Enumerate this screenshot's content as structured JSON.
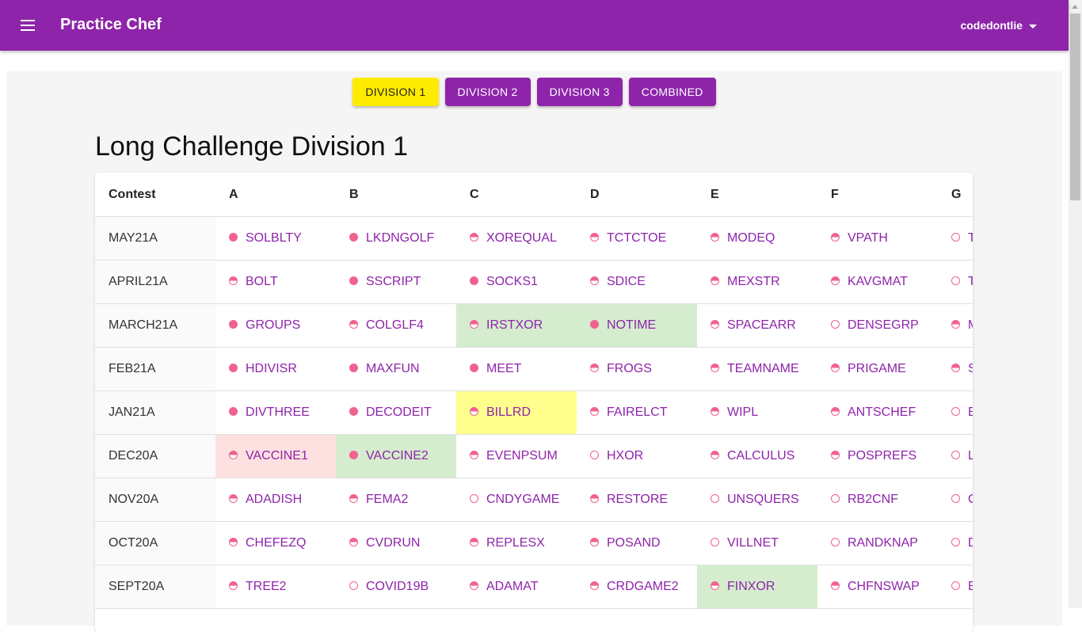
{
  "app": {
    "title": "Practice Chef",
    "user": "codedontlie"
  },
  "tabs": [
    {
      "label": "DIVISION 1",
      "active": true
    },
    {
      "label": "DIVISION 2",
      "active": false
    },
    {
      "label": "DIVISION 3",
      "active": false
    },
    {
      "label": "COMBINED",
      "active": false
    }
  ],
  "page_title": "Long Challenge Division 1",
  "table": {
    "headers": [
      "Contest",
      "A",
      "B",
      "C",
      "D",
      "E",
      "F",
      "G"
    ],
    "rows": [
      {
        "contest": "MAY21A",
        "cells": [
          {
            "code": "SOLBLTY",
            "status": "full"
          },
          {
            "code": "LKDNGOLF",
            "status": "full"
          },
          {
            "code": "XOREQUAL",
            "status": "half"
          },
          {
            "code": "TCTCTOE",
            "status": "half"
          },
          {
            "code": "MODEQ",
            "status": "half"
          },
          {
            "code": "VPATH",
            "status": "half"
          },
          {
            "code": "T",
            "status": "empty"
          }
        ]
      },
      {
        "contest": "APRIL21A",
        "cells": [
          {
            "code": "BOLT",
            "status": "half"
          },
          {
            "code": "SSCRIPT",
            "status": "full"
          },
          {
            "code": "SOCKS1",
            "status": "full"
          },
          {
            "code": "SDICE",
            "status": "half"
          },
          {
            "code": "MEXSTR",
            "status": "half"
          },
          {
            "code": "KAVGMAT",
            "status": "half"
          },
          {
            "code": "T",
            "status": "empty"
          }
        ]
      },
      {
        "contest": "MARCH21A",
        "cells": [
          {
            "code": "GROUPS",
            "status": "full"
          },
          {
            "code": "COLGLF4",
            "status": "half"
          },
          {
            "code": "IRSTXOR",
            "status": "half",
            "highlight": "green"
          },
          {
            "code": "NOTIME",
            "status": "full",
            "highlight": "green"
          },
          {
            "code": "SPACEARR",
            "status": "half"
          },
          {
            "code": "DENSEGRP",
            "status": "empty"
          },
          {
            "code": "M",
            "status": "half"
          }
        ]
      },
      {
        "contest": "FEB21A",
        "cells": [
          {
            "code": "HDIVISR",
            "status": "full"
          },
          {
            "code": "MAXFUN",
            "status": "full"
          },
          {
            "code": "MEET",
            "status": "full"
          },
          {
            "code": "FROGS",
            "status": "half"
          },
          {
            "code": "TEAMNAME",
            "status": "half"
          },
          {
            "code": "PRIGAME",
            "status": "half"
          },
          {
            "code": "S",
            "status": "half"
          }
        ]
      },
      {
        "contest": "JAN21A",
        "cells": [
          {
            "code": "DIVTHREE",
            "status": "full"
          },
          {
            "code": "DECODEIT",
            "status": "full"
          },
          {
            "code": "BILLRD",
            "status": "half",
            "highlight": "yellow"
          },
          {
            "code": "FAIRELCT",
            "status": "half"
          },
          {
            "code": "WIPL",
            "status": "half"
          },
          {
            "code": "ANTSCHEF",
            "status": "half"
          },
          {
            "code": "E",
            "status": "empty"
          }
        ]
      },
      {
        "contest": "DEC20A",
        "cells": [
          {
            "code": "VACCINE1",
            "status": "half",
            "highlight": "red"
          },
          {
            "code": "VACCINE2",
            "status": "full",
            "highlight": "green"
          },
          {
            "code": "EVENPSUM",
            "status": "half"
          },
          {
            "code": "HXOR",
            "status": "empty"
          },
          {
            "code": "CALCULUS",
            "status": "half"
          },
          {
            "code": "POSPREFS",
            "status": "half"
          },
          {
            "code": "L",
            "status": "empty"
          }
        ]
      },
      {
        "contest": "NOV20A",
        "cells": [
          {
            "code": "ADADISH",
            "status": "half"
          },
          {
            "code": "FEMA2",
            "status": "half"
          },
          {
            "code": "CNDYGAME",
            "status": "empty"
          },
          {
            "code": "RESTORE",
            "status": "half"
          },
          {
            "code": "UNSQUERS",
            "status": "empty"
          },
          {
            "code": "RB2CNF",
            "status": "empty"
          },
          {
            "code": "C",
            "status": "empty"
          }
        ]
      },
      {
        "contest": "OCT20A",
        "cells": [
          {
            "code": "CHEFEZQ",
            "status": "half"
          },
          {
            "code": "CVDRUN",
            "status": "half"
          },
          {
            "code": "REPLESX",
            "status": "half"
          },
          {
            "code": "POSAND",
            "status": "half"
          },
          {
            "code": "VILLNET",
            "status": "empty"
          },
          {
            "code": "RANDKNAP",
            "status": "empty"
          },
          {
            "code": "D",
            "status": "empty"
          }
        ]
      },
      {
        "contest": "SEPT20A",
        "cells": [
          {
            "code": "TREE2",
            "status": "half"
          },
          {
            "code": "COVID19B",
            "status": "empty"
          },
          {
            "code": "ADAMAT",
            "status": "half"
          },
          {
            "code": "CRDGAME2",
            "status": "half"
          },
          {
            "code": "FINXOR",
            "status": "half",
            "highlight": "green"
          },
          {
            "code": "CHFNSWAP",
            "status": "half"
          },
          {
            "code": "E",
            "status": "empty"
          }
        ]
      }
    ]
  }
}
